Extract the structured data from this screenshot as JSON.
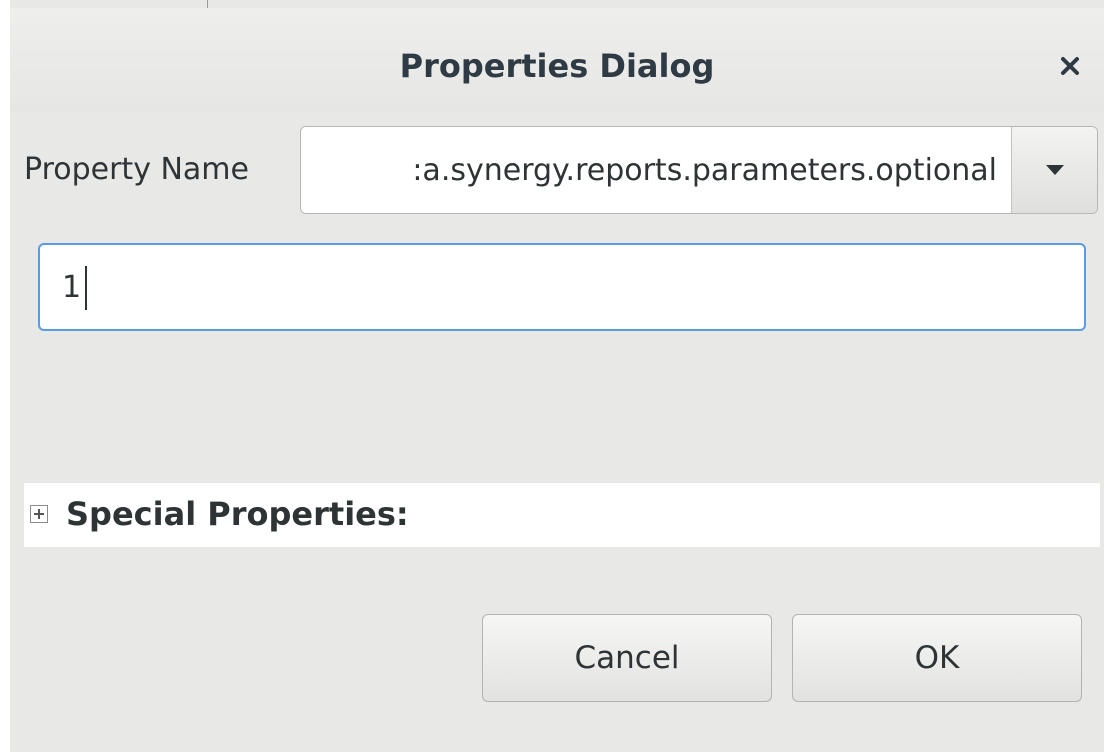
{
  "dialog": {
    "title": "Properties Dialog",
    "close_icon": "close-icon"
  },
  "property_name": {
    "label": "Property Name",
    "value": ":a.synergy.reports.parameters.optional",
    "dropdown_icon": "chevron-down-icon"
  },
  "value_field": {
    "value": "1"
  },
  "special_properties": {
    "label": "Special Properties:",
    "expander_icon": "plus-box-icon"
  },
  "buttons": {
    "cancel_label": "Cancel",
    "ok_label": "OK"
  }
}
